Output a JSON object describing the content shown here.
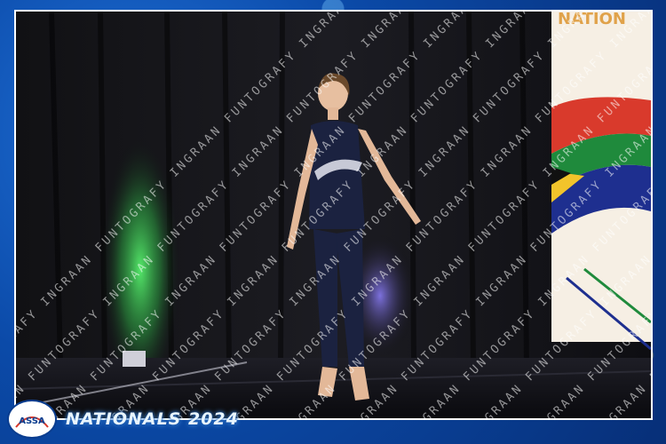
{
  "event_title": "NATIONALS 2024",
  "logo_text": "ASSA",
  "watermark_text": "INGRAAN FUNTOGRAFY",
  "banner_text": "NATION",
  "colors": {
    "frame_blue": "#0b4aa8",
    "stage_black": "#0d0d0f",
    "spotlight_green": "#3bd15a",
    "spotlight_purple": "#6b5cff",
    "costume_navy": "#1b2240"
  }
}
